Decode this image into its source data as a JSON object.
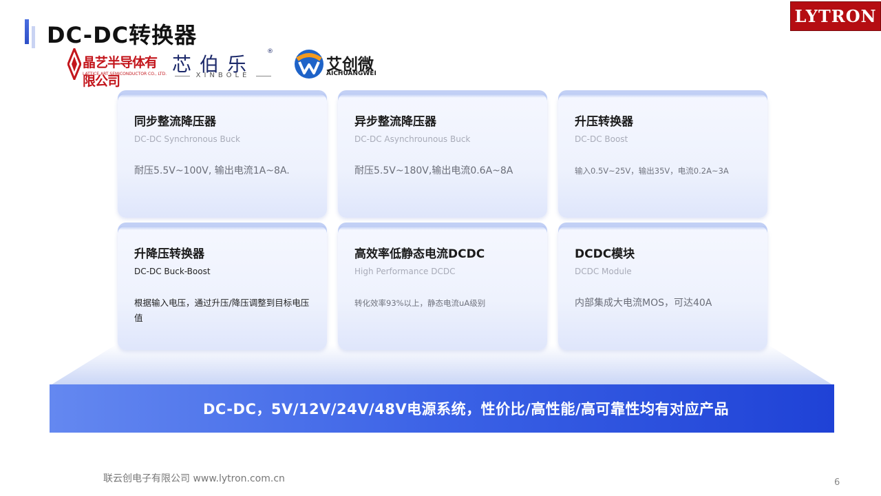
{
  "header": {
    "title": "DC-DC转换器",
    "brand": "LYTRON"
  },
  "partners": [
    {
      "name": "晶艺半导体有限公司",
      "sub": "LATTICE ART SEMICONDUCTOR CO., LTD."
    },
    {
      "name": "芯伯乐",
      "sub": "XINBOLE",
      "mark": "®"
    },
    {
      "name": "艾创微",
      "sub": "AICHUANGWEI"
    }
  ],
  "cards": [
    {
      "title": "同步整流降压器",
      "subtitle": "DC-DC Synchronous Buck",
      "desc": "耐压5.5V~100V, 输出电流1A~8A."
    },
    {
      "title": "异步整流降压器",
      "subtitle": "DC-DC Asynchrounous Buck",
      "desc": "耐压5.5V~180V,输出电流0.6A~8A"
    },
    {
      "title": "升压转换器",
      "subtitle": "DC-DC Boost",
      "desc": "输入0.5V~25V，输出35V，电流0.2A~3A"
    },
    {
      "title": "升降压转换器",
      "subtitle": "DC-DC Buck-Boost",
      "desc": "根据输入电压，通过升压/降压调整到目标电压值"
    },
    {
      "title": "高效率低静态电流DCDC",
      "subtitle": "High Performance DCDC",
      "desc": "转化效率93%以上，静态电流uA级别"
    },
    {
      "title": "DCDC模块",
      "subtitle": "DCDC Module",
      "desc": "内部集成大电流MOS，可达40A"
    }
  ],
  "banner": "DC-DC，5V/12V/24V/48V电源系统，性价比/高性能/高可靠性均有对应产品",
  "footer": "联云创电子有限公司 www.lytron.com.cn",
  "page_number": "6",
  "colors": {
    "accent": "#3b62e6",
    "brand_red": "#b50d12"
  }
}
